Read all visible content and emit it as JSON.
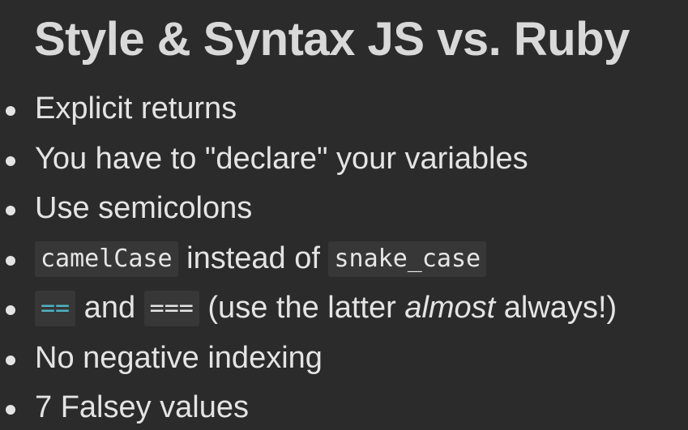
{
  "slide": {
    "title": "Style & Syntax JS vs. Ruby",
    "bullets": {
      "b1": "Explicit returns",
      "b2": "You have to \"declare\" your variables",
      "b3": "Use semicolons",
      "b4": {
        "code1": "camelCase",
        "text": " instead of ",
        "code2": "snake_case"
      },
      "b5": {
        "code1": "==",
        "text1": " and ",
        "code2": "===",
        "text2": " (use the latter ",
        "emphasis": "almost",
        "text3": " always!)"
      },
      "b6": "No negative indexing",
      "b7": "7 Falsey values"
    }
  },
  "colors": {
    "background": "#2b2b2b",
    "text": "#e4e4e4",
    "code_background": "#373737",
    "code_accent": "#4fb3c2"
  }
}
